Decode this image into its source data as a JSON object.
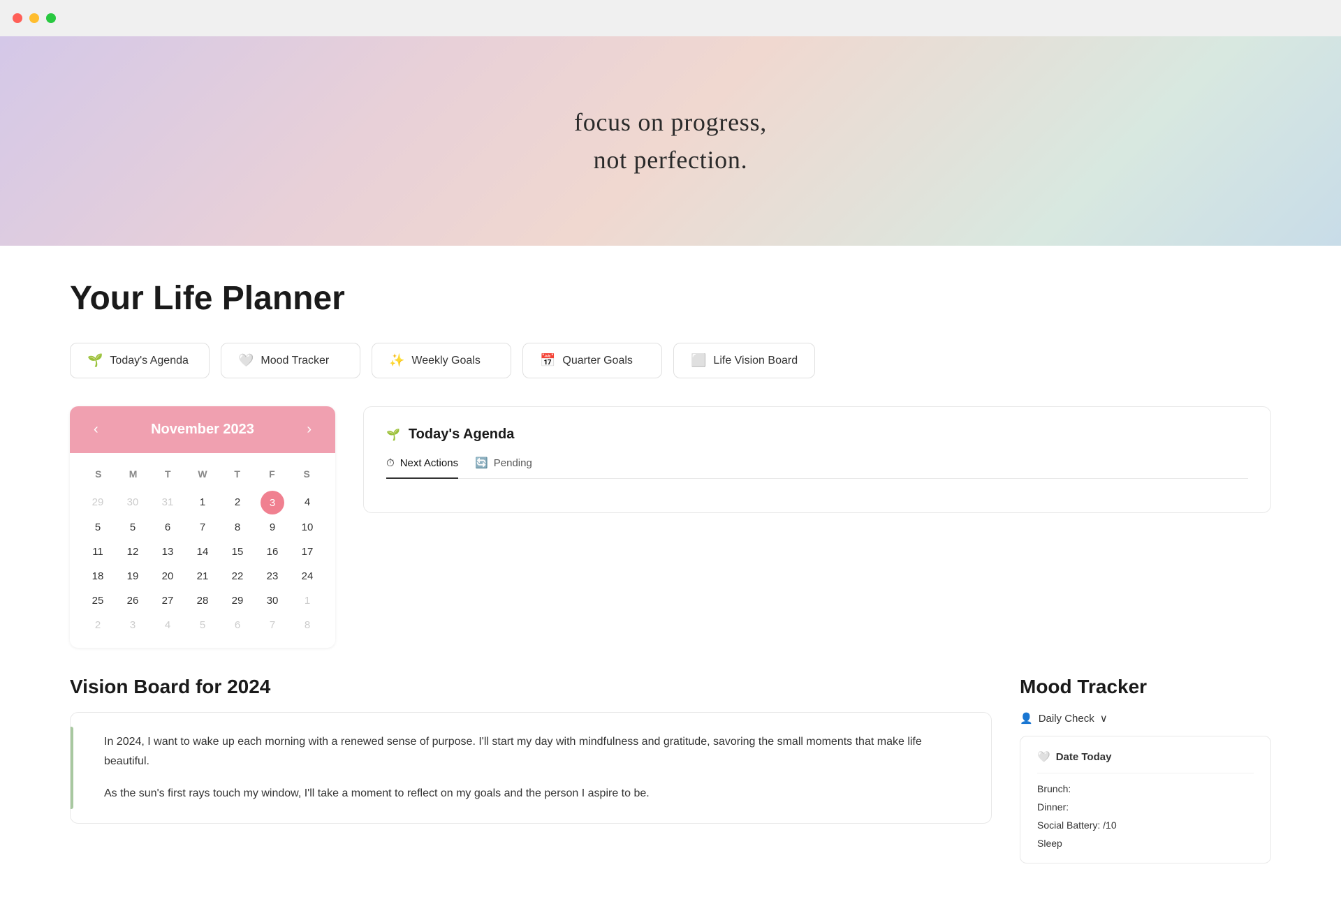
{
  "titlebar": {
    "close_color": "#ff5f57",
    "minimize_color": "#ffbd2e",
    "maximize_color": "#28c840"
  },
  "hero": {
    "quote_line1": "focus on progress,",
    "quote_line2": "not perfection."
  },
  "page": {
    "title": "Your Life Planner"
  },
  "nav": {
    "pills": [
      {
        "icon": "🌱",
        "label": "Today's Agenda"
      },
      {
        "icon": "🤍",
        "label": "Mood Tracker"
      },
      {
        "icon": "✨",
        "label": "Weekly Goals"
      },
      {
        "icon": "📅",
        "label": "Quarter Goals"
      },
      {
        "icon": "⬜",
        "label": "Life Vision Board"
      }
    ]
  },
  "calendar": {
    "month": "November 2023",
    "weekdays": [
      "S",
      "M",
      "T",
      "W",
      "T",
      "F",
      "S"
    ],
    "rows": [
      [
        {
          "day": "29",
          "other": true
        },
        {
          "day": "30",
          "other": true
        },
        {
          "day": "31",
          "other": true
        },
        {
          "day": "1"
        },
        {
          "day": "2"
        },
        {
          "day": "3",
          "today": true
        },
        {
          "day": "4"
        }
      ],
      [
        {
          "day": "5"
        },
        {
          "day": "5"
        },
        {
          "day": "6"
        },
        {
          "day": "7"
        },
        {
          "day": "8"
        },
        {
          "day": "9"
        },
        {
          "day": "10"
        }
      ],
      [
        {
          "day": "11"
        },
        {
          "day": "12"
        },
        {
          "day": "13"
        },
        {
          "day": "14"
        },
        {
          "day": "15"
        },
        {
          "day": "16"
        },
        {
          "day": "17"
        }
      ],
      [
        {
          "day": "18"
        },
        {
          "day": "19"
        },
        {
          "day": "20"
        },
        {
          "day": "21"
        },
        {
          "day": "22"
        },
        {
          "day": "23"
        },
        {
          "day": "24"
        }
      ],
      [
        {
          "day": "25"
        },
        {
          "day": "26"
        },
        {
          "day": "27"
        },
        {
          "day": "28"
        },
        {
          "day": "29"
        },
        {
          "day": "30"
        },
        {
          "day": "1",
          "other": true
        }
      ],
      [
        {
          "day": "2",
          "other": true
        },
        {
          "day": "3",
          "other": true
        },
        {
          "day": "4",
          "other": true
        },
        {
          "day": "5",
          "other": true
        },
        {
          "day": "6",
          "other": true
        },
        {
          "day": "7",
          "other": true
        },
        {
          "day": "8",
          "other": true
        }
      ]
    ]
  },
  "agenda": {
    "icon": "🌱",
    "title": "Today's Agenda",
    "tabs": [
      {
        "icon": "⏱",
        "label": "Next Actions",
        "active": true
      },
      {
        "icon": "🔄",
        "label": "Pending",
        "active": false
      }
    ]
  },
  "vision_board": {
    "title": "Vision Board for 2024",
    "paragraph1": "In 2024, I want to wake up each morning with a renewed sense of purpose. I'll start my day with mindfulness and gratitude, savoring the small moments that make life beautiful.",
    "paragraph2": "As the sun's first rays touch my window, I'll take a moment to reflect on my goals and the person I aspire to be."
  },
  "mood_tracker": {
    "title": "Mood Tracker",
    "daily_check_label": "Daily Check",
    "chevron": "∨",
    "date_icon": "🤍",
    "date_label": "Date Today",
    "fields": [
      {
        "label": "Brunch:",
        "value": ""
      },
      {
        "label": "Dinner:",
        "value": ""
      },
      {
        "label": "Social Battery: /10",
        "value": ""
      },
      {
        "label": "Sleep",
        "value": ""
      }
    ]
  }
}
